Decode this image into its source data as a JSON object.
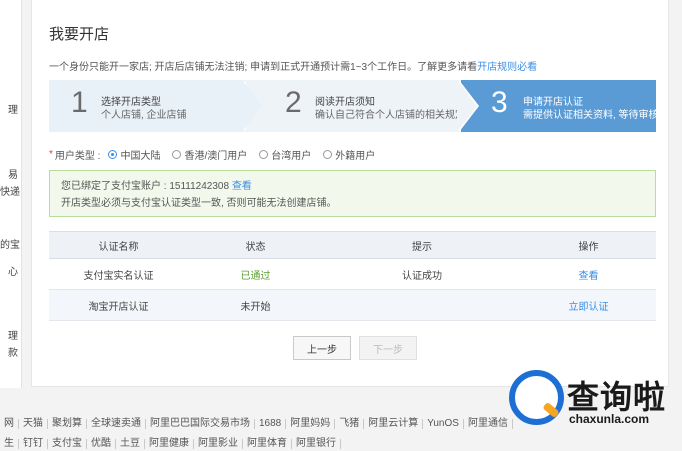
{
  "sidebar": {
    "fragments": [
      "理",
      "易",
      "快递",
      "的宝",
      "心",
      "理",
      "款"
    ]
  },
  "page": {
    "title": "我要开店",
    "intro_text": "一个身份只能开一家店; 开店后店铺无法注销; 申请到正式开通预计需1~3个工作日。了解更多请看",
    "intro_link": "开店规则必看"
  },
  "steps": [
    {
      "num": "1",
      "title": "选择开店类型",
      "desc": "个人店铺, 企业店铺"
    },
    {
      "num": "2",
      "title": "阅读开店须知",
      "desc": "确认自己符合个人店铺的相关规定"
    },
    {
      "num": "3",
      "title": "申请开店认证",
      "desc": "需提供认证相关资料, 等待审核通"
    }
  ],
  "user_type": {
    "label": "用户类型 :",
    "options": [
      "中国大陆",
      "香港/澳门用户",
      "台湾用户",
      "外籍用户"
    ],
    "selected": "中国大陆"
  },
  "notice": {
    "line1": "您已绑定了支付宝账户 : 15111242308",
    "line1_link": "查看",
    "line2": "开店类型必须与支付宝认证类型一致, 否则可能无法创建店铺。"
  },
  "table": {
    "headers": [
      "认证名称",
      "状态",
      "提示",
      "操作"
    ],
    "rows": [
      {
        "name": "支付宝实名认证",
        "status": "已通过",
        "hint": "认证成功",
        "action": "查看"
      },
      {
        "name": "淘宝开店认证",
        "status": "未开始",
        "hint": "",
        "action": "立即认证"
      }
    ]
  },
  "buttons": {
    "prev": "上一步",
    "next": "下一步"
  },
  "footer": {
    "row1": [
      "网",
      "天猫",
      "聚划算",
      "全球速卖通",
      "阿里巴巴国际交易市场",
      "1688",
      "阿里妈妈",
      "飞猪",
      "阿里云计算",
      "YunOS",
      "阿里通信"
    ],
    "row2": [
      "生",
      "钉钉",
      "支付宝",
      "优酷",
      "土豆",
      "阿里健康",
      "阿里影业",
      "阿里体育",
      "阿里银行"
    ]
  },
  "watermark": {
    "text": "查询啦",
    "url": "chaxunla.com"
  },
  "colors": {
    "accent": "#3a8ee6",
    "step_active": "#5b9bd5",
    "success": "#5aa02c",
    "notice_bg": "#f2f9ec"
  }
}
